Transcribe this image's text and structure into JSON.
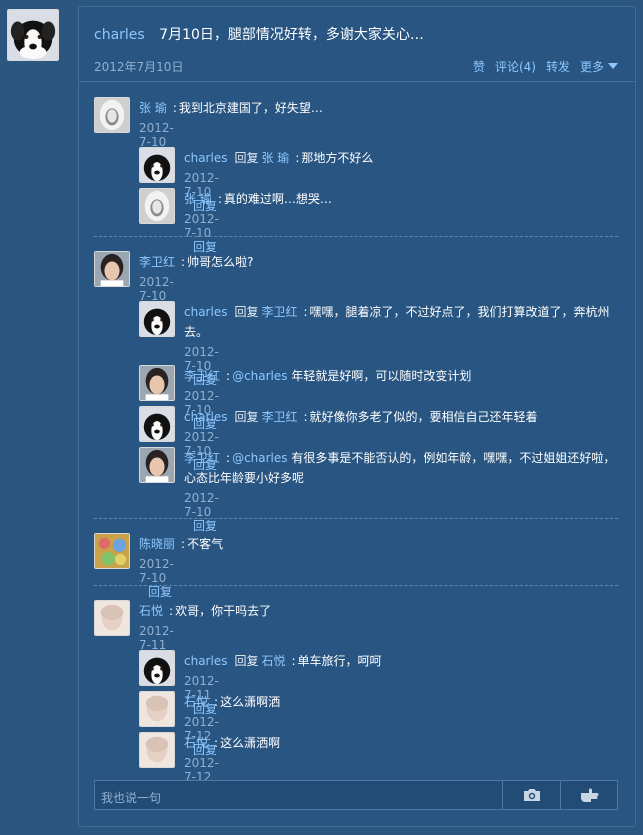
{
  "post": {
    "author": "charles",
    "text": "7月10日，腿部情况好转，多谢大家关心…",
    "date": "2012年7月10日",
    "actions": {
      "like": "赞",
      "comment": "评论(4)",
      "share": "转发",
      "more": "更多"
    }
  },
  "reply_label": "回复",
  "reply_word": "回复",
  "comments": [
    {
      "name": "张 瑜",
      "text": "我到北京建国了，好失望…",
      "date": "2012-7-10",
      "replies": [
        {
          "name": "charles",
          "to": "张 瑜",
          "text": "那地方不好么",
          "date": "2012-7-10"
        },
        {
          "name": "张 瑜",
          "text": "真的难过啊…想哭…",
          "date": "2012-7-10"
        }
      ]
    },
    {
      "name": "李卫红",
      "text": "帅哥怎么啦?",
      "date": "2012-7-10",
      "replies": [
        {
          "name": "charles",
          "to": "李卫红",
          "text": "嘿嘿，腿着凉了，不过好点了，我们打算改道了，奔杭州去。",
          "date": "2012-7-10"
        },
        {
          "name": "李卫红",
          "mention": "@charles",
          "text": "年轻就是好啊，可以随时改变计划",
          "date": "2012-7-10"
        },
        {
          "name": "charles",
          "to": "李卫红",
          "text": "就好像你多老了似的，要相信自己还年轻着",
          "date": "2012-7-10"
        },
        {
          "name": "李卫红",
          "mention": "@charles",
          "text": "有很多事是不能否认的，例如年龄，嘿嘿，不过姐姐还好啦，心态比年龄要小好多呢",
          "date": "2012-7-10"
        }
      ]
    },
    {
      "name": "陈晓丽",
      "text": "不客气",
      "date": "2012-7-10",
      "replies": []
    },
    {
      "name": "石悦",
      "text": "欢哥，你干吗去了",
      "date": "2012-7-11",
      "replies": [
        {
          "name": "charles",
          "to": "石悦",
          "text": "单车旅行，呵呵",
          "date": "2012-7-11"
        },
        {
          "name": "石悦",
          "text": "这么潇啊洒",
          "date": "2012-7-12"
        },
        {
          "name": "石悦",
          "text": "这么潇洒啊",
          "date": "2012-7-12"
        }
      ]
    }
  ],
  "input": {
    "placeholder": "我也说一句",
    "camera_icon": "camera-icon",
    "hand_icon": "pointing-hand-icon"
  },
  "colors": {
    "background": "#2a5680",
    "link": "#8ec8ff",
    "muted": "#8fb0d0"
  }
}
